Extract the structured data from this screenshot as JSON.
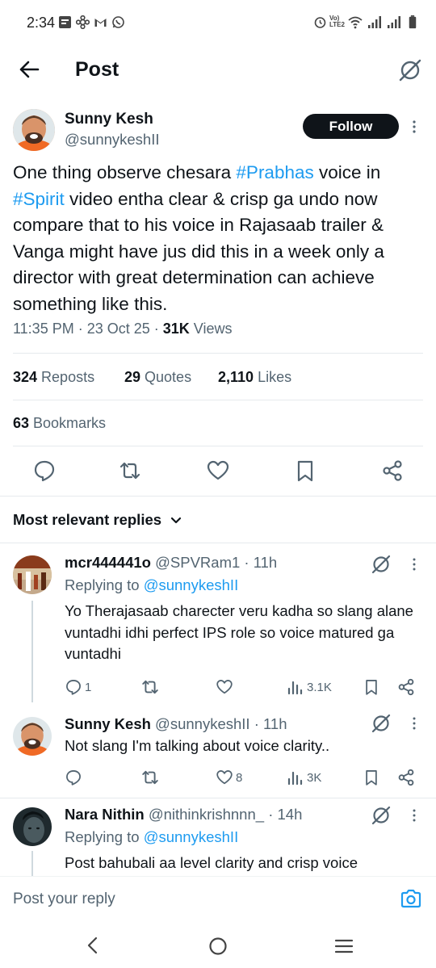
{
  "status_bar": {
    "time": "2:34",
    "network": "Vo) LTE2"
  },
  "header": {
    "title": "Post"
  },
  "post": {
    "author_name": "Sunny Kesh",
    "author_handle": "@sunnykeshII",
    "follow_label": "Follow",
    "text_parts": {
      "p1": "One thing observe chesara ",
      "tag1": "#Prabhas",
      "p2": " voice in ",
      "tag2": "#Spirit",
      "p3": " video entha clear & crisp ga undo now compare that to his voice in Rajasaab trailer & Vanga might have jus did this in a week only a director with great determination can achieve something like this."
    },
    "timestamp": "11:35 PM · 23 Oct 25 · ",
    "views_count": "31K",
    "views_label": " Views",
    "stats": {
      "reposts_count": "324",
      "reposts_label": " Reposts",
      "quotes_count": "29",
      "quotes_label": " Quotes",
      "likes_count": "2,110",
      "likes_label": " Likes",
      "bookmarks_count": "63",
      "bookmarks_label": " Bookmarks"
    }
  },
  "replies_header": {
    "label": "Most relevant replies"
  },
  "replies": [
    {
      "name": "mcr444441o",
      "handle_time": " @SPVRam1 · 11h",
      "replying_prefix": "Replying to ",
      "replying_to": "@sunnykeshII",
      "text": "Yo Therajasaab charecter veru kadha so slang alane vuntadhi idhi perfect IPS role so voice matured ga vuntadhi",
      "replies": "1",
      "likes": "",
      "views": "3.1K"
    },
    {
      "name": "Sunny Kesh",
      "handle_time": " @sunnykeshII · 11h",
      "text": "Not slang I'm talking about voice clarity..",
      "replies": "",
      "likes": "8",
      "views": "3K"
    },
    {
      "name": "Nara Nithin",
      "handle_time": " @nithinkrishnnn_ · 14h",
      "replying_prefix": "Replying to ",
      "replying_to": "@sunnykeshII",
      "text": "Post bahubali aa level clarity and crisp voice"
    }
  ],
  "composer": {
    "placeholder": "Post your reply"
  },
  "colors": {
    "accent": "#1d9bf0",
    "text": "#0f1419",
    "muted": "#536471",
    "follow_bg": "#0f1419"
  }
}
